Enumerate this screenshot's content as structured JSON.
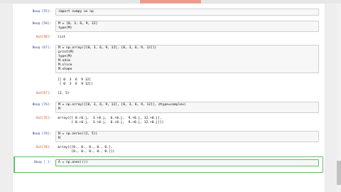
{
  "cells": [
    {
      "in_prompt": "Ввод [55]:",
      "code": [
        "import numpy as np"
      ],
      "out_prompt": "",
      "output": []
    },
    {
      "in_prompt": "Ввод [58]:",
      "code": [
        "M = [0, 3, 6, 9, 12]",
        "type(M)"
      ],
      "out_prompt": "Out[58]:",
      "output": [
        "list"
      ]
    },
    {
      "in_prompt": "Ввод [67]:",
      "code": [
        "M = np.array([[0, 3, 6, 9, 12], [0, 3, 6, 9, 12]])",
        "print(M)",
        "type(M)",
        "M.ndim",
        "M.slice",
        "M.shape"
      ],
      "out_prompt": "",
      "output": [
        "[[ 0  3  6  9 12]",
        " [ 0  3  6  9 12]]"
      ],
      "out_prompt2": "Out[67]:",
      "output2": [
        "(2, 5)"
      ]
    },
    {
      "in_prompt": "Ввод [76]:",
      "code": [
        "M = np.array([[0, 3, 6, 9, 12], [0, 3, 6, 9, 12]], dtype=complex)",
        "M"
      ],
      "out_prompt": "Out[76]:",
      "output": [
        "array([[ 0.+0.j,  3.+0.j,  6.+0.j,  9.+0.j, 12.+0.j],",
        "       [ 0.+0.j,  3.+0.j,  6.+0.j,  9.+0.j, 12.+0.j]])"
      ]
    },
    {
      "in_prompt": "Ввод [78]:",
      "code": [
        "N = np.zeros((2, 5))",
        "N"
      ],
      "out_prompt": "Out[78]:",
      "output": [
        "array([[0., 0., 0., 0., 0.],",
        "       [0., 0., 0., 0., 0.]])"
      ]
    },
    {
      "in_prompt": "Ввод [ ]:",
      "code": [
        "A = np.ones(())"
      ],
      "out_prompt": "",
      "output": []
    }
  ]
}
